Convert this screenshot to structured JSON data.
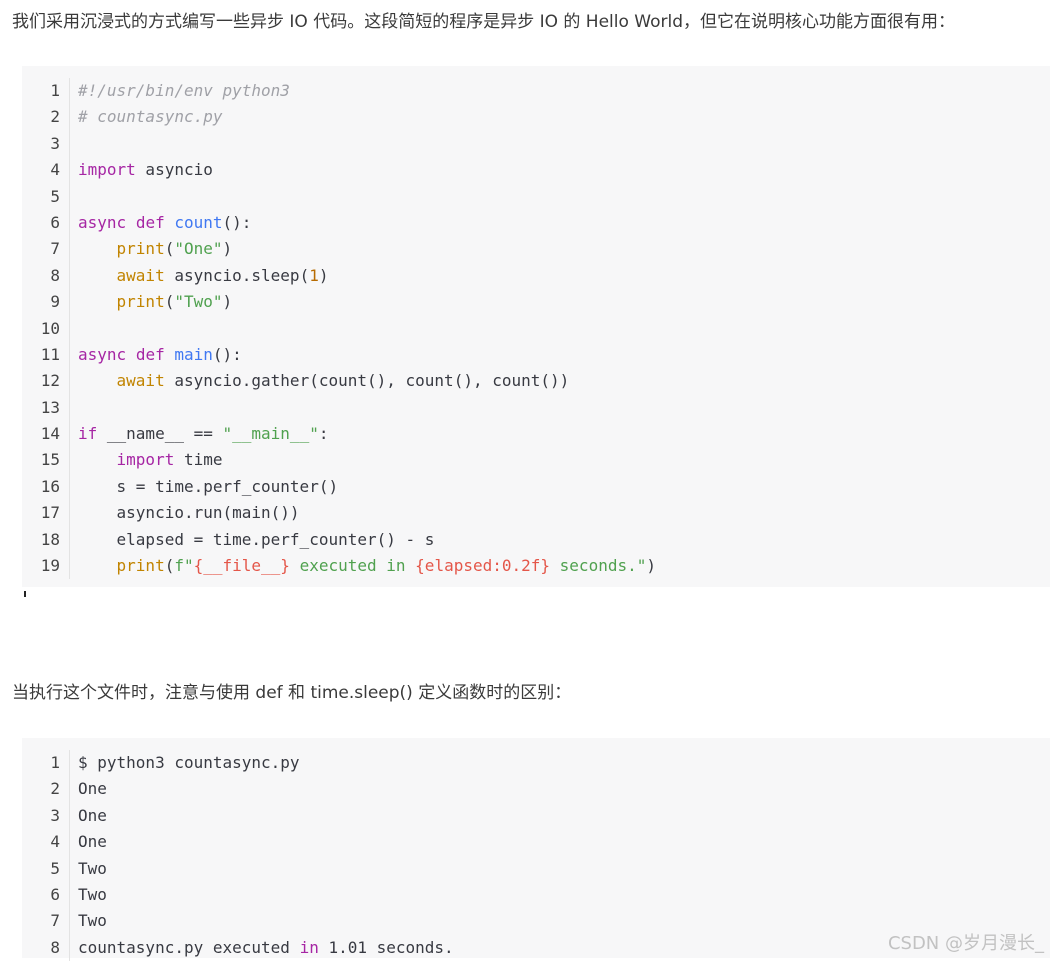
{
  "intro_text": "我们采用沉浸式的方式编写一些异步 IO 代码。这段简短的程序是异步 IO 的 Hello World，但它在说明核心功能方面很有用：",
  "code_block_1": {
    "lines": [
      [
        [
          "#!/usr/bin/env python3",
          "cm"
        ]
      ],
      [
        [
          "# countasync.py",
          "cm"
        ]
      ],
      [],
      [
        [
          "import",
          "kw"
        ],
        [
          " asyncio",
          ""
        ]
      ],
      [],
      [
        [
          "async",
          "kw"
        ],
        [
          " ",
          ""
        ],
        [
          "def",
          "kw"
        ],
        [
          " ",
          ""
        ],
        [
          "count",
          "fn"
        ],
        [
          "():",
          ""
        ]
      ],
      [
        [
          "    ",
          ""
        ],
        [
          "print",
          "bi"
        ],
        [
          "(",
          ""
        ],
        [
          "\"One\"",
          "st"
        ],
        [
          ")",
          ""
        ]
      ],
      [
        [
          "    ",
          ""
        ],
        [
          "await",
          "bi"
        ],
        [
          " asyncio.sleep(",
          ""
        ],
        [
          "1",
          "nu"
        ],
        [
          ")",
          ""
        ]
      ],
      [
        [
          "    ",
          ""
        ],
        [
          "print",
          "bi"
        ],
        [
          "(",
          ""
        ],
        [
          "\"Two\"",
          "st"
        ],
        [
          ")",
          ""
        ]
      ],
      [],
      [
        [
          "async",
          "kw"
        ],
        [
          " ",
          ""
        ],
        [
          "def",
          "kw"
        ],
        [
          " ",
          ""
        ],
        [
          "main",
          "fn"
        ],
        [
          "():",
          ""
        ]
      ],
      [
        [
          "    ",
          ""
        ],
        [
          "await",
          "bi"
        ],
        [
          " asyncio.gather(count(), count(), count())",
          ""
        ]
      ],
      [],
      [
        [
          "if",
          "kw"
        ],
        [
          " __name__ == ",
          ""
        ],
        [
          "\"__main__\"",
          "st"
        ],
        [
          ":",
          ""
        ]
      ],
      [
        [
          "    ",
          ""
        ],
        [
          "import",
          "kw"
        ],
        [
          " time",
          ""
        ]
      ],
      [
        [
          "    s = time.perf_counter()",
          ""
        ]
      ],
      [
        [
          "    asyncio.run(main())",
          ""
        ]
      ],
      [
        [
          "    elapsed = time.perf_counter() - s",
          ""
        ]
      ],
      [
        [
          "    ",
          ""
        ],
        [
          "print",
          "bi"
        ],
        [
          "(",
          ""
        ],
        [
          "f\"",
          "st"
        ],
        [
          "{__file__}",
          "ip"
        ],
        [
          " executed in ",
          "st"
        ],
        [
          "{elapsed:0.2f}",
          "ip"
        ],
        [
          " seconds.\"",
          "st"
        ],
        [
          ")",
          ""
        ]
      ]
    ]
  },
  "middle_text": "当执行这个文件时，注意与使用 def 和 time.sleep() 定义函数时的区别：",
  "code_block_2": {
    "lines": [
      [
        [
          "$ python3 countasync.py",
          ""
        ]
      ],
      [
        [
          "One",
          ""
        ]
      ],
      [
        [
          "One",
          ""
        ]
      ],
      [
        [
          "One",
          ""
        ]
      ],
      [
        [
          "Two",
          ""
        ]
      ],
      [
        [
          "Two",
          ""
        ]
      ],
      [
        [
          "Two",
          ""
        ]
      ],
      [
        [
          "countasync.py executed ",
          ""
        ],
        [
          "in",
          "kw"
        ],
        [
          " 1.01 seconds.",
          ""
        ]
      ]
    ]
  },
  "watermark": "CSDN @岁月漫长_"
}
